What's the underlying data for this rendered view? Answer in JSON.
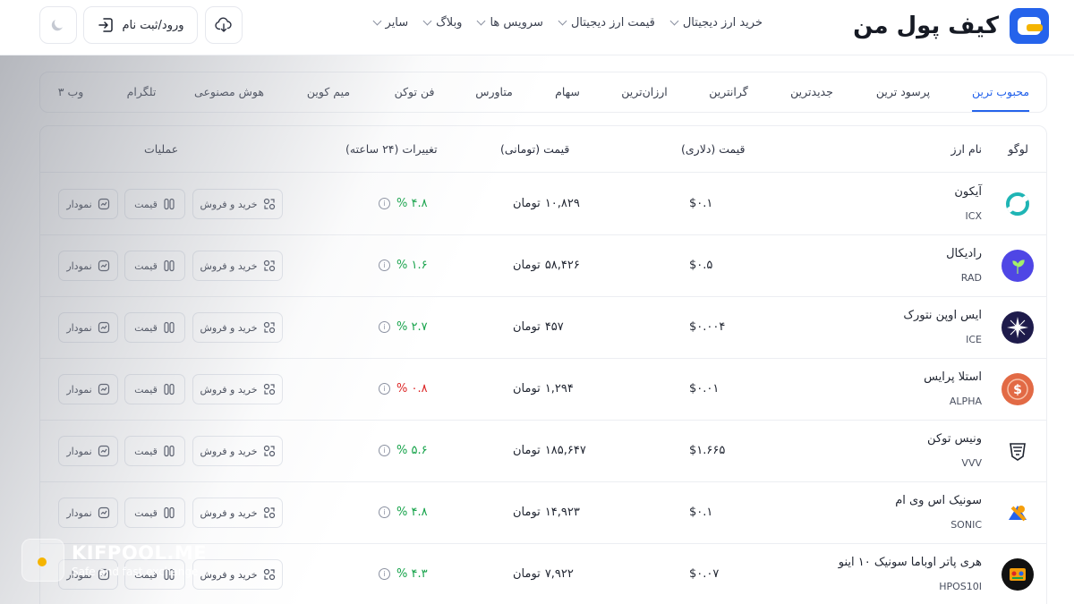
{
  "header": {
    "brand": "کیف پول من",
    "nav": [
      {
        "label": "خرید ارز دیجیتال"
      },
      {
        "label": "قیمت ارز دیجیتال"
      },
      {
        "label": "سرویس ها"
      },
      {
        "label": "وبلاگ"
      },
      {
        "label": "سایر"
      }
    ],
    "login_label": "ورود/ثبت نام"
  },
  "tabs": [
    {
      "label": "محبوب ترین",
      "active": true
    },
    {
      "label": "پرسود ترین"
    },
    {
      "label": "جدیدترین"
    },
    {
      "label": "گرانترین"
    },
    {
      "label": "ارزان‌ترین"
    },
    {
      "label": "سهام"
    },
    {
      "label": "متاورس"
    },
    {
      "label": "فن توکن"
    },
    {
      "label": "میم کوین"
    },
    {
      "label": "هوش مصنوعی"
    },
    {
      "label": "تلگرام"
    },
    {
      "label": "وب ۳"
    }
  ],
  "table": {
    "columns": {
      "logo": "لوگو",
      "name": "نام ارز",
      "usd": "قیمت (دلاری)",
      "irt": "قیمت (تومانی)",
      "change": "تغییرات (۲۴ ساعته)",
      "actions": "عملیات"
    },
    "currency_unit": "تومان",
    "actions": {
      "trade": "خرید و فروش",
      "price": "قیمت",
      "chart": "نمودار"
    },
    "rows": [
      {
        "name": "آیکون",
        "symbol": "ICX",
        "usd": "$۰.۱",
        "irt": "۱۰,۸۲۹",
        "change": "% ۴.۸",
        "dir": "up",
        "logo_color": "#1fb5b5"
      },
      {
        "name": "رادیکال",
        "symbol": "RAD",
        "usd": "$۰.۵",
        "irt": "۵۸,۴۲۶",
        "change": "% ۱.۶",
        "dir": "up",
        "logo_color": "#4f46e5"
      },
      {
        "name": "ایس اوپن نتورک",
        "symbol": "ICE",
        "usd": "$۰.۰۰۴",
        "irt": "۴۵۷",
        "change": "% ۲.۷",
        "dir": "up",
        "logo_color": "#1e1b4b"
      },
      {
        "name": "استلا پرایس",
        "symbol": "ALPHA",
        "usd": "$۰.۰۱",
        "irt": "۱,۲۹۴",
        "change": "% ۰.۸",
        "dir": "down",
        "logo_color": "#e26a45"
      },
      {
        "name": "ونیس توکن",
        "symbol": "VVV",
        "usd": "$۱.۶۶۵",
        "irt": "۱۸۵,۶۴۷",
        "change": "% ۵.۶",
        "dir": "up",
        "logo_color": "#ffffff"
      },
      {
        "name": "سونیک اس وی ام",
        "symbol": "SONIC",
        "usd": "$۰.۱",
        "irt": "۱۴,۹۲۳",
        "change": "% ۴.۸",
        "dir": "up",
        "logo_color": "#ffffff"
      },
      {
        "name": "هری پاتر اوباما سونیک ۱۰ اینو",
        "symbol": "HPOS10I",
        "usd": "$۰.۰۷",
        "irt": "۷,۹۲۲",
        "change": "% ۴.۳",
        "dir": "up",
        "logo_color": "#111111"
      }
    ]
  },
  "watermark": {
    "title": "KIFPOOL.ME",
    "subtitle": "Safe and fast exchange"
  },
  "colors": {
    "accent": "#2563eb",
    "up": "#16a34a",
    "down": "#dc2626",
    "logo_yellow": "#f5b400"
  },
  "icons": {
    "login": "login-arrow-icon",
    "cloud": "cloud-download-icon",
    "moon": "moon-icon",
    "trade": "exchange-icon",
    "price": "price-icon",
    "chart": "chart-icon",
    "info": "info-icon"
  }
}
